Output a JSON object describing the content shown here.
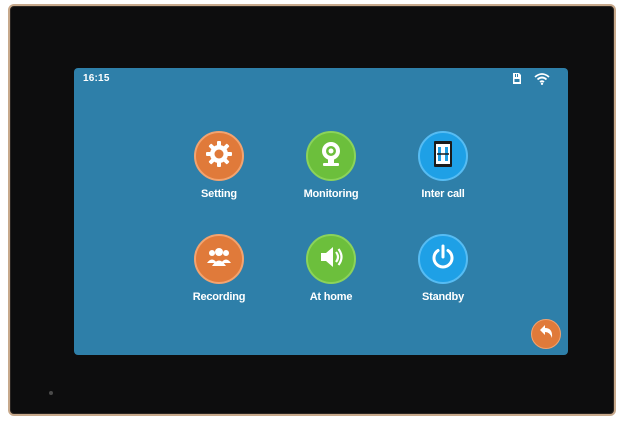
{
  "status_bar": {
    "time": "16:15",
    "icons": [
      "sd-card-icon",
      "wifi-icon"
    ]
  },
  "menu": {
    "items": [
      {
        "label": "Setting",
        "icon": "gear-icon",
        "color": "#e07a3a"
      },
      {
        "label": "Monitoring",
        "icon": "camera-icon",
        "color": "#6cbf3c"
      },
      {
        "label": "Inter call",
        "icon": "intercom-icon",
        "color": "#1ea0e6"
      },
      {
        "label": "Recording",
        "icon": "people-icon",
        "color": "#e07a3a"
      },
      {
        "label": "At home",
        "icon": "speaker-icon",
        "color": "#6cbf3c"
      },
      {
        "label": "Standby",
        "icon": "power-icon",
        "color": "#1ea0e6"
      }
    ]
  },
  "back_button": {
    "icon": "back-arrow-icon",
    "color": "#e07a3a"
  },
  "colors": {
    "screen_background": "#2e7fa9",
    "bezel": "#0d0d0e",
    "frame_border": "#c7a98c"
  }
}
